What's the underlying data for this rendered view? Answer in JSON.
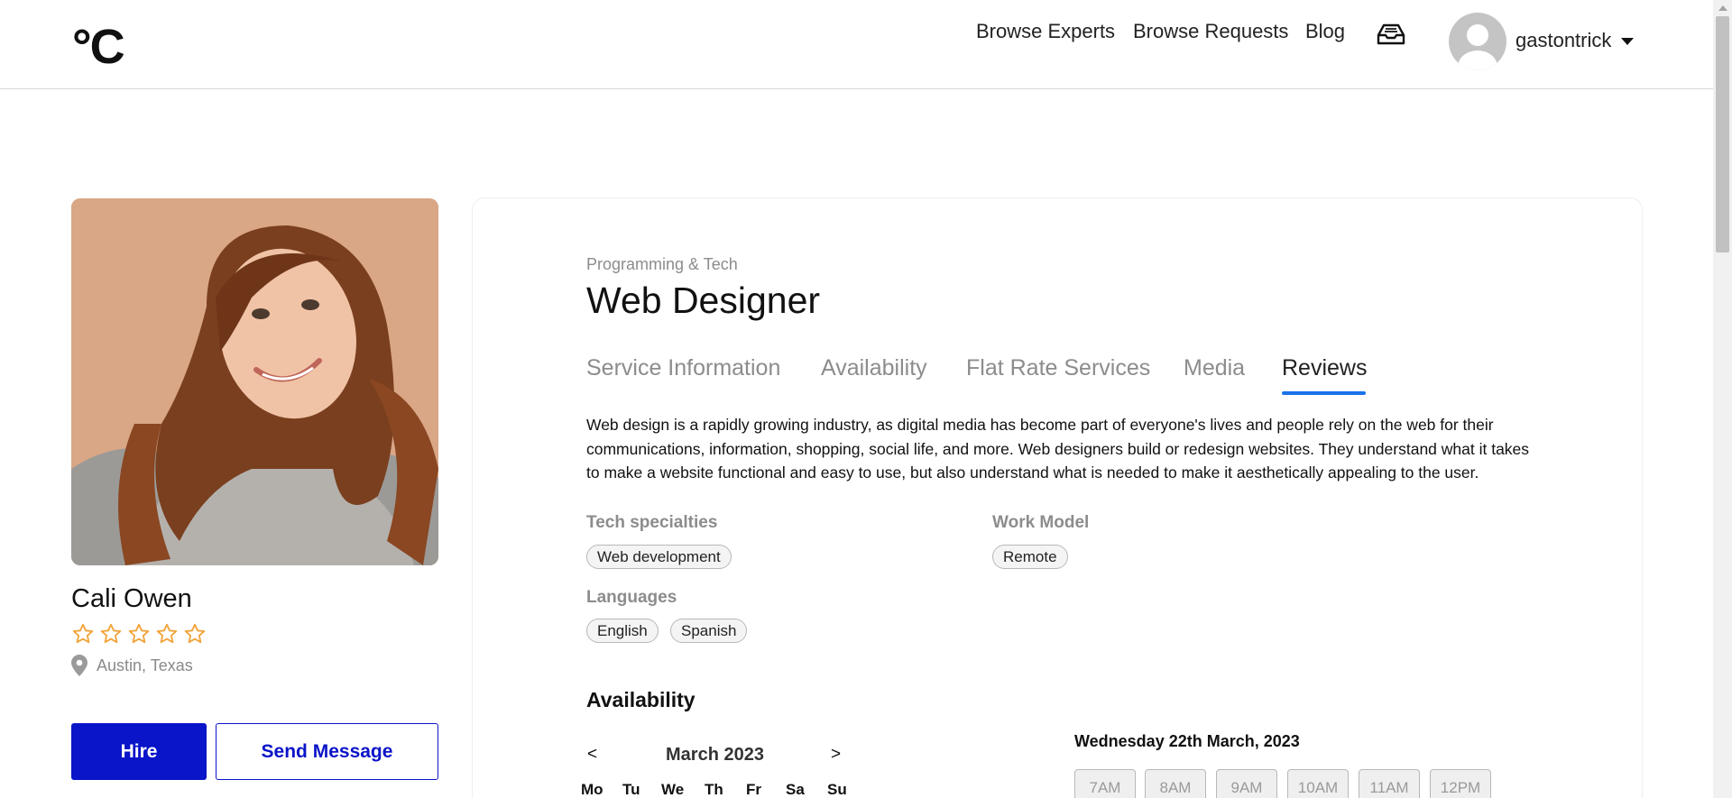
{
  "header": {
    "logo": "°C",
    "nav": [
      "Browse Experts",
      "Browse Requests",
      "Blog"
    ],
    "username": "gastontrick"
  },
  "profile": {
    "name": "Cali Owen",
    "rating": 0,
    "rating_max": 5,
    "location": "Austin, Texas",
    "hire_label": "Hire",
    "message_label": "Send Message"
  },
  "service": {
    "category": "Programming & Tech",
    "title": "Web Designer",
    "tabs": [
      "Service Information",
      "Availability",
      "Flat Rate Services",
      "Media",
      "Reviews"
    ],
    "active_tab": "Reviews",
    "description": "Web design is a rapidly growing industry, as digital media has become part of everyone's lives and people rely on the web for their communications, information, shopping, social life, and more. Web designers build or redesign websites. They understand what it takes to make a website functional and easy to use, but also understand what is needed to make it aesthetically appealing to the user.",
    "tech_label": "Tech specialties",
    "tech": [
      "Web development"
    ],
    "work_model_label": "Work Model",
    "work_model": [
      "Remote"
    ],
    "languages_label": "Languages",
    "languages": [
      "English",
      "Spanish"
    ]
  },
  "availability": {
    "heading": "Availability",
    "prev": "<",
    "next": ">",
    "month": "March 2023",
    "weekdays": [
      "Mo",
      "Tu",
      "We",
      "Th",
      "Fr",
      "Sa",
      "Su"
    ],
    "selected_date": "Wednesday 22th March, 2023",
    "slots": [
      "7AM",
      "8AM",
      "9AM",
      "10AM",
      "11AM",
      "12PM"
    ]
  },
  "colors": {
    "primary": "#0a14c8",
    "tab_accent": "#1a73e8",
    "star": "#f2a33a",
    "muted": "#8c8c8c"
  },
  "icons": [
    "inbox-icon",
    "avatar-icon",
    "caret-down-icon",
    "star-outline-icon",
    "map-pin-icon"
  ]
}
